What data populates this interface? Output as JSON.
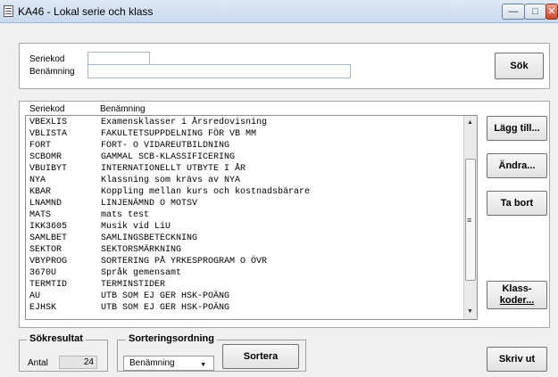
{
  "window": {
    "title": "KA46 - Lokal serie och klass",
    "minimize_glyph": "—",
    "maximize_glyph": "□",
    "close_glyph": "✕"
  },
  "search": {
    "seriekod_label": "Seriekod",
    "benamning_label": "Benämning",
    "seriekod_value": "",
    "benamning_value": "",
    "search_button": "Sök"
  },
  "list": {
    "headers": [
      "Seriekod",
      "Benämning"
    ],
    "rows": [
      {
        "code": "VBEXLIS",
        "name": "Examensklasser i Årsredovisning"
      },
      {
        "code": "VBLISTA",
        "name": "FAKULTETSUPPDELNING FÖR VB MM"
      },
      {
        "code": "FORT",
        "name": "FORT- O VIDAREUTBILDNING"
      },
      {
        "code": "SCBOMR",
        "name": "GAMMAL SCB-KLASSIFICERING"
      },
      {
        "code": "VBUIBYT",
        "name": "INTERNATIONELLT UTBYTE I ÅR"
      },
      {
        "code": "NYA",
        "name": "Klassning som krävs av NYA"
      },
      {
        "code": "KBAR",
        "name": "Koppling mellan kurs och kostnadsbärare"
      },
      {
        "code": "LNAMND",
        "name": "LINJENÄMND O MOTSV"
      },
      {
        "code": "MATS",
        "name": "mats test"
      },
      {
        "code": "IKK3605",
        "name": "Musik vid LiU"
      },
      {
        "code": "SAMLBET",
        "name": "SAMLINGSBETECKNING"
      },
      {
        "code": "SEKTOR",
        "name": "SEKTORSMÄRKNING"
      },
      {
        "code": "VBYPROG",
        "name": "SORTERING PÅ YRKESPROGRAM O ÖVR"
      },
      {
        "code": "3670U",
        "name": "Språk gemensamt"
      },
      {
        "code": "TERMTID",
        "name": "TERMINSTIDER"
      },
      {
        "code": "AU",
        "name": "UTB SOM EJ GER HSK-POÄNG"
      },
      {
        "code": "EJHSK",
        "name": "UTB SOM EJ GER HSK-POÄNG"
      }
    ],
    "scroll_up": "▲",
    "scroll_down": "▼",
    "grip": "≡"
  },
  "actions": {
    "add": "Lägg till...",
    "edit": "Ändra...",
    "delete": "Ta bort",
    "class_codes_1": "Klass-",
    "class_codes_2": "koder...",
    "print": "Skriv ut"
  },
  "result": {
    "title": "Sökresultat",
    "count_label": "Antal",
    "count_value": "24"
  },
  "sort": {
    "title": "Sorteringsordning",
    "selected": "Benämning",
    "caret": "▼",
    "button": "Sortera"
  }
}
